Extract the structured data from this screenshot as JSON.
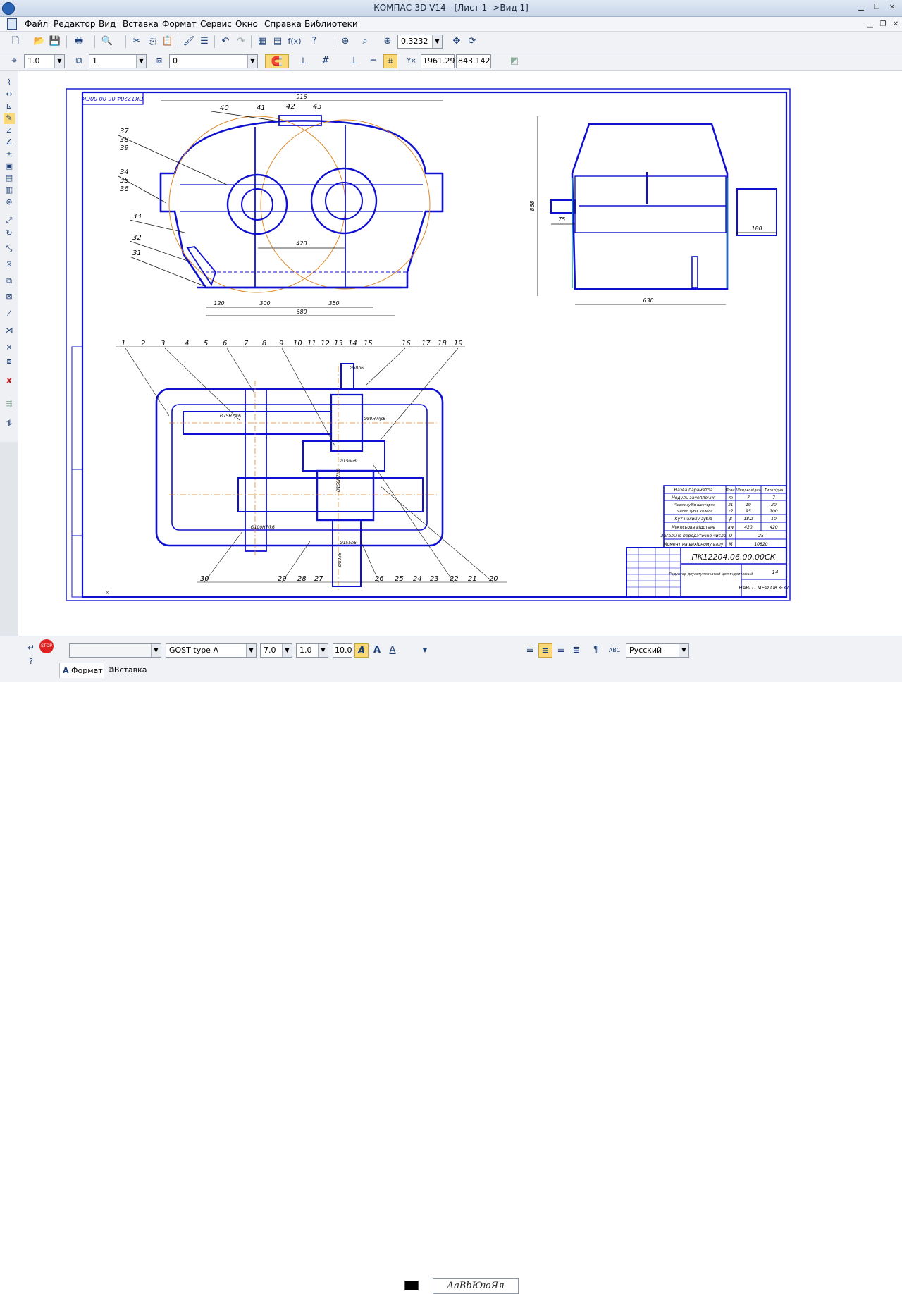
{
  "window": {
    "title": "КОМПАС-3D V14 - [Лист 1 ->Вид 1]"
  },
  "menu": [
    "Файл",
    "Редактор",
    "Вид",
    "Вставка",
    "Формат",
    "Сервис",
    "Окно",
    "Справка",
    "Библиотеки"
  ],
  "toolbar": {
    "zoom_value": "0.3232",
    "fx_label": "f(x)",
    "layer_step": "1.0",
    "view_number": "1",
    "layer_number": "0",
    "coord_x": "1961.29",
    "coord_y": "843.142"
  },
  "text_format": {
    "font": "GOST type A",
    "height": "7.0",
    "width_factor": "1.0",
    "step": "10.0",
    "preview": "АаВbЮюЯя",
    "language": "Русский"
  },
  "bottom_tabs": [
    "Формат",
    "Вставка"
  ],
  "drawing": {
    "stamp_rotated": "ПК12204.06.00.00СК",
    "stamp_main": "ПК12204.06.00.00СК",
    "stamp_name": "Редуктор двухступенчатый цилиндрический",
    "sheet": "14",
    "org": "НАВГП МЕФ ОКЗ-37",
    "dims": {
      "front_width": "916",
      "center_dist": "420",
      "base_1": "120",
      "base_2": "300",
      "base_3": "350",
      "base_total": "680",
      "side_height": "868",
      "side_shaft": "75",
      "side_coupling": "180",
      "side_base": "630",
      "plan_dim_1": "Ø60h6",
      "plan_fit_1": "Ø75H7/k6",
      "plan_fit_2": "Ø80H7/js6",
      "plan_fit_3": "Ø150H7/s6",
      "plan_fit_4": "Ø100H7/k6",
      "plan_dim_2": "Ø150h6",
      "plan_dim_3": "Ø155h6",
      "plan_dim_4": "Ø80k6"
    },
    "front_callouts": [
      "40",
      "41",
      "42",
      "43",
      "37",
      "38",
      "39",
      "34",
      "35",
      "36",
      "33",
      "32",
      "31"
    ],
    "top_callouts": [
      "1",
      "2",
      "3",
      "4",
      "5",
      "6",
      "7",
      "8",
      "9",
      "10",
      "11",
      "12",
      "13",
      "14",
      "15",
      "16",
      "17",
      "18",
      "19"
    ],
    "bottom_callouts": [
      "30",
      "29",
      "28",
      "27",
      "26",
      "25",
      "24",
      "23",
      "22",
      "21",
      "20"
    ],
    "spec_headers": [
      "Назва параметра",
      "Позн.",
      "Швидкохідна",
      "Тихохідна"
    ],
    "spec_rows": [
      [
        "Модуль зачеплення",
        "m",
        "7",
        "7"
      ],
      [
        "Число зубів шестерня",
        "z1",
        "19",
        "20"
      ],
      [
        "Число зубів колеса",
        "z2",
        "95",
        "100"
      ],
      [
        "Кут нахилу зубів",
        "β",
        "18.2",
        "10"
      ],
      [
        "Міжосьова відстань",
        "aw",
        "420",
        "420"
      ],
      [
        "Загальне передаточне число",
        "U",
        "25",
        ""
      ],
      [
        "Момент на вихідному валу",
        "M",
        "10820",
        ""
      ]
    ]
  }
}
